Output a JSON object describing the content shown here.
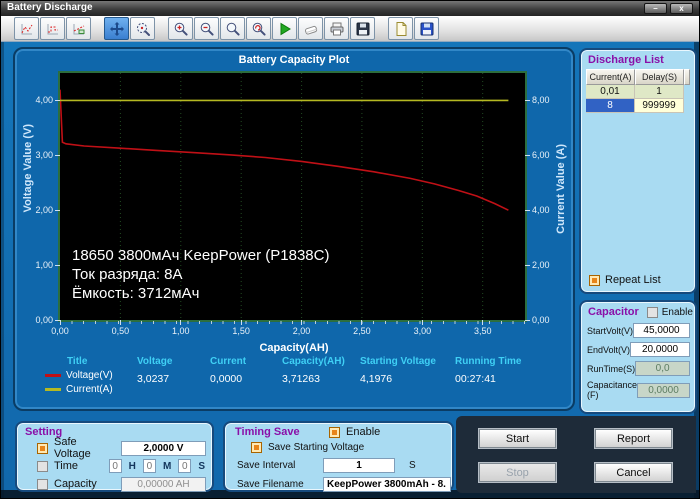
{
  "window": {
    "title": "Battery Discharge",
    "buttons": {
      "minimize": "–",
      "close": "x"
    }
  },
  "toolbar": {
    "buttons": [
      "curve-plot",
      "step-plot",
      "legend-plot",
      "pan-fit",
      "zoom-track",
      "zoom-in",
      "zoom-out",
      "zoom-window",
      "zoom-reset",
      "run",
      "erase",
      "print",
      "save",
      "new-file",
      "save-data"
    ]
  },
  "chart_data": {
    "type": "line",
    "title": "Battery Capacity Plot",
    "xlabel": "Capacity(AH)",
    "ylabel_left": "Voltage Value (V)",
    "ylabel_right": "Current Value (A)",
    "xlim": [
      0,
      3.85
    ],
    "ylim_left": [
      0,
      4.5
    ],
    "ylim_right": [
      0,
      9
    ],
    "x_ticks": [
      "0,00",
      "0,50",
      "1,00",
      "1,50",
      "2,00",
      "2,50",
      "3,00",
      "3,50"
    ],
    "y_ticks_left": [
      "0,00",
      "1,00",
      "2,00",
      "3,00",
      "4,00"
    ],
    "y_ticks_right": [
      "0,00",
      "2,00",
      "4,00",
      "6,00",
      "8,00"
    ],
    "grid": "vertical-dotted",
    "series": [
      {
        "name": "Voltage(V)",
        "color": "#c01016",
        "axis": "left",
        "x": [
          0,
          0.02,
          0.05,
          0.2,
          0.5,
          0.8,
          1.1,
          1.4,
          1.7,
          2.0,
          2.3,
          2.6,
          2.9,
          3.1,
          3.3,
          3.45,
          3.6,
          3.7126
        ],
        "y": [
          4.1976,
          3.24,
          3.21,
          3.17,
          3.13,
          3.09,
          3.05,
          3.01,
          2.96,
          2.89,
          2.8,
          2.7,
          2.58,
          2.48,
          2.36,
          2.26,
          2.12,
          2.0
        ]
      },
      {
        "name": "Current(A)",
        "color": "#b5b922",
        "axis": "right",
        "x": [
          0,
          3.7126
        ],
        "y": [
          8,
          8
        ]
      }
    ],
    "annotation": [
      "18650 3800мАч KeepPower (P1838C)",
      "Ток разряда: 8А",
      "Ёмкость: 3712мАч"
    ]
  },
  "stats": {
    "headers": [
      "Title",
      "Voltage",
      "Current",
      "Capacity(AH)",
      "Starting Voltage",
      "Running Time"
    ],
    "values": [
      "3,0237",
      "0,0000",
      "3,71263",
      "4,1976",
      "00:27:41"
    ],
    "legend": [
      {
        "label": "Voltage(V)",
        "color": "#c01016"
      },
      {
        "label": "Current(A)",
        "color": "#b5b922"
      }
    ]
  },
  "discharge_list": {
    "title": "Discharge List",
    "columns": [
      "Current(A)",
      "Delay(S)"
    ],
    "rows": [
      {
        "current": "0,01",
        "delay": "1"
      },
      {
        "current": "8",
        "delay": "999999"
      }
    ],
    "selected_row": 1,
    "repeat_label": "Repeat List",
    "repeat_checked": true
  },
  "capacitor": {
    "title": "Capacitor",
    "enable_label": "Enable",
    "enable_checked": false,
    "fields": [
      {
        "label": "StartVolt(V)",
        "value": "45,0000"
      },
      {
        "label": "EndVolt(V)",
        "value": "20,0000"
      },
      {
        "label": "RunTime(S)",
        "value": "0,0"
      },
      {
        "label": "Capacitance\n(F)",
        "value": "0,0000"
      }
    ]
  },
  "setting": {
    "title": "Setting",
    "safe_voltage": {
      "label": "Safe Voltage",
      "value": "2,0000 V",
      "checked": true
    },
    "time": {
      "label": "Time",
      "h": "0",
      "m": "0",
      "s": "0",
      "units": [
        "H",
        "M",
        "S"
      ],
      "checked": false
    },
    "capacity": {
      "label": "Capacity",
      "value": "0,00000 AH",
      "checked": false
    }
  },
  "timing_save": {
    "title": "Timing Save",
    "enable_label": "Enable",
    "enable_checked": true,
    "save_starting_voltage_label": "Save Starting Voltage",
    "save_starting_voltage_checked": true,
    "save_interval_label": "Save Interval",
    "save_interval_value": "1",
    "save_interval_unit": "S",
    "save_filename_label": "Save Filename",
    "save_filename_value": "KeepPower 3800mAh - 8."
  },
  "actions": {
    "start": "Start",
    "stop": "Stop",
    "report": "Report",
    "cancel": "Cancel"
  }
}
